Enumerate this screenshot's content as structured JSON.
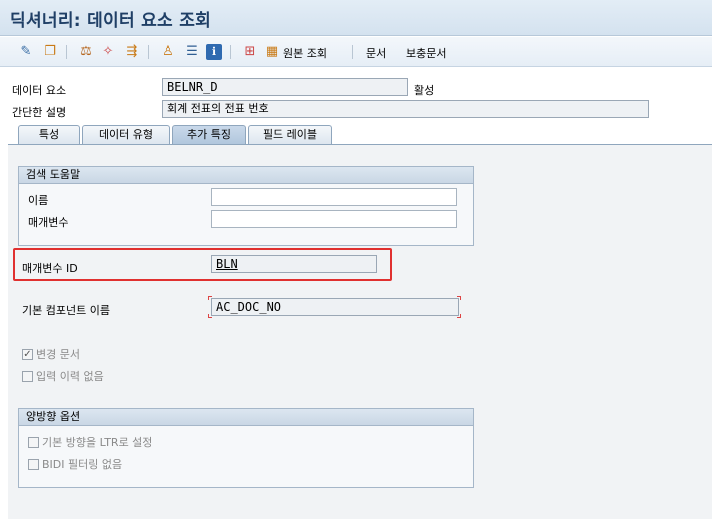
{
  "window": {
    "title": "딕셔너리: 데이터 요소 조회"
  },
  "toolbar": {
    "icons": [
      {
        "name": "display-change-icon",
        "glyph": "✎"
      },
      {
        "name": "other-object-icon",
        "glyph": "❐"
      },
      {
        "name": "check-icon",
        "glyph": "⚖"
      },
      {
        "name": "activate-icon",
        "glyph": "✧"
      },
      {
        "name": "where-used-icon",
        "glyph": "⇶"
      },
      {
        "name": "hierarchy-icon",
        "glyph": "♙"
      },
      {
        "name": "display-object-list-icon",
        "glyph": "☰"
      },
      {
        "name": "info-icon",
        "glyph": "ℹ"
      },
      {
        "name": "object-tree-icon",
        "glyph": "⊞"
      }
    ],
    "original_view_label": "원본 조회",
    "document_label": "문서",
    "supplementary_doc_label": "보충문서"
  },
  "header": {
    "data_element_label": "데이터 요소",
    "data_element_value": "BELNR_D",
    "status": "활성",
    "short_desc_label": "간단한 설명",
    "short_desc_value": "회계 전표의 전표 번호"
  },
  "tabs": [
    {
      "label": "특성",
      "active": false
    },
    {
      "label": "데이터 유형",
      "active": false
    },
    {
      "label": "추가 특징",
      "active": true
    },
    {
      "label": "필드 레이블",
      "active": false
    }
  ],
  "search_help": {
    "title": "검색 도움말",
    "name_label": "이름",
    "name_value": "",
    "param_label": "매개변수",
    "param_value": ""
  },
  "parameter_id": {
    "label": "매개변수 ID",
    "value": "BLN"
  },
  "default_component": {
    "label": "기본 컴포넌트 이름",
    "value": "AC_DOC_NO"
  },
  "change_document": {
    "label": "변경 문서",
    "checked": true
  },
  "no_input_history": {
    "label": "입력 이력 없음",
    "checked": false
  },
  "bidi": {
    "title": "양방향 옵션",
    "ltr_label": "기본 방향을 LTR로 설정",
    "ltr_checked": false,
    "no_filter_label": "BIDI 필터링 없음",
    "no_filter_checked": false
  }
}
